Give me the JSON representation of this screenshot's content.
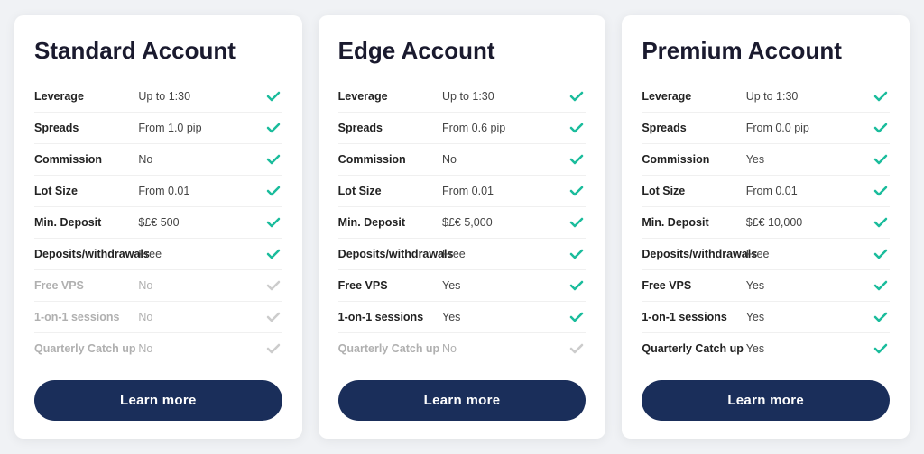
{
  "cards": [
    {
      "id": "standard",
      "title": "Standard Account",
      "button_label": "Learn more",
      "features": [
        {
          "label": "Leverage",
          "value": "Up to 1:30",
          "active": true
        },
        {
          "label": "Spreads",
          "value": "From 1.0 pip",
          "active": true
        },
        {
          "label": "Commission",
          "value": "No",
          "active": true
        },
        {
          "label": "Lot Size",
          "value": "From 0.01",
          "active": true
        },
        {
          "label": "Min. Deposit",
          "value": "$£€ 500",
          "active": true
        },
        {
          "label": "Deposits/withdrawals",
          "value": "Free",
          "active": true
        },
        {
          "label": "Free VPS",
          "value": "No",
          "active": false
        },
        {
          "label": "1-on-1 sessions",
          "value": "No",
          "active": false
        },
        {
          "label": "Quarterly Catch up",
          "value": "No",
          "active": false
        }
      ]
    },
    {
      "id": "edge",
      "title": "Edge Account",
      "button_label": "Learn more",
      "features": [
        {
          "label": "Leverage",
          "value": "Up to 1:30",
          "active": true
        },
        {
          "label": "Spreads",
          "value": "From 0.6 pip",
          "active": true
        },
        {
          "label": "Commission",
          "value": "No",
          "active": true
        },
        {
          "label": "Lot Size",
          "value": "From 0.01",
          "active": true
        },
        {
          "label": "Min. Deposit",
          "value": "$£€ 5,000",
          "active": true
        },
        {
          "label": "Deposits/withdrawals",
          "value": "Free",
          "active": true
        },
        {
          "label": "Free VPS",
          "value": "Yes",
          "active": true
        },
        {
          "label": "1-on-1 sessions",
          "value": "Yes",
          "active": true
        },
        {
          "label": "Quarterly Catch up",
          "value": "No",
          "active": false
        }
      ]
    },
    {
      "id": "premium",
      "title": "Premium Account",
      "button_label": "Learn more",
      "features": [
        {
          "label": "Leverage",
          "value": "Up to 1:30",
          "active": true
        },
        {
          "label": "Spreads",
          "value": "From 0.0 pip",
          "active": true
        },
        {
          "label": "Commission",
          "value": "Yes",
          "active": true
        },
        {
          "label": "Lot Size",
          "value": "From 0.01",
          "active": true
        },
        {
          "label": "Min. Deposit",
          "value": "$£€ 10,000",
          "active": true
        },
        {
          "label": "Deposits/withdrawals",
          "value": "Free",
          "active": true
        },
        {
          "label": "Free VPS",
          "value": "Yes",
          "active": true
        },
        {
          "label": "1-on-1 sessions",
          "value": "Yes",
          "active": true
        },
        {
          "label": "Quarterly Catch up",
          "value": "Yes",
          "active": true
        }
      ]
    }
  ]
}
